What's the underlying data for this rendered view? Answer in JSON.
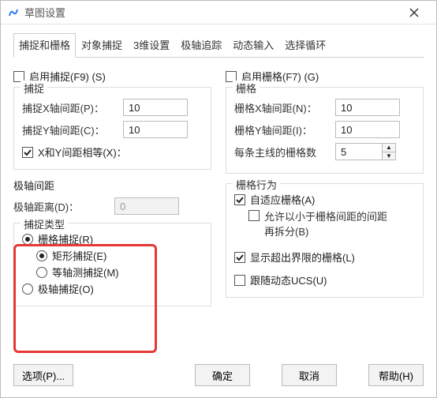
{
  "window": {
    "title": "草图设置"
  },
  "tabs": [
    {
      "label": "捕捉和栅格",
      "active": true
    },
    {
      "label": "对象捕捉",
      "active": false
    },
    {
      "label": "3维设置",
      "active": false
    },
    {
      "label": "极轴追踪",
      "active": false
    },
    {
      "label": "动态输入",
      "active": false
    },
    {
      "label": "选择循环",
      "active": false
    }
  ],
  "left": {
    "enable_snap_label": "启用捕捉(F9) (S)",
    "snap_legend": "捕捉",
    "snap_x_label": "捕捉X轴间距(P)：",
    "snap_x_value": "10",
    "snap_y_label": "捕捉Y轴间距(C)：",
    "snap_y_value": "10",
    "equal_xy_label": "X和Y间距相等(X)：",
    "polar_legend": "极轴间距",
    "polar_dist_label": "极轴距离(D)：",
    "polar_dist_value": "0",
    "snap_type_legend": "捕捉类型",
    "grid_snap_label": "栅格捕捉(R)",
    "rect_snap_label": "矩形捕捉(E)",
    "iso_snap_label": "等轴测捕捉(M)",
    "polar_snap_label": "极轴捕捉(O)"
  },
  "right": {
    "enable_grid_label": "启用栅格(F7) (G)",
    "grid_legend": "栅格",
    "grid_x_label": "栅格X轴间距(N)：",
    "grid_x_value": "10",
    "grid_y_label": "栅格Y轴间距(I)：",
    "grid_y_value": "10",
    "major_lines_label": "每条主线的栅格数",
    "major_lines_value": "5",
    "behavior_legend": "栅格行为",
    "adaptive_label": "自适应栅格(A)",
    "sub_split_label": "允许以小于栅格间距的间距再拆分(B)",
    "show_beyond_label": "显示超出界限的栅格(L)",
    "follow_ucs_label": "跟随动态UCS(U)"
  },
  "buttons": {
    "options": "选项(P)...",
    "ok": "确定",
    "cancel": "取消",
    "help": "帮助(H)"
  }
}
